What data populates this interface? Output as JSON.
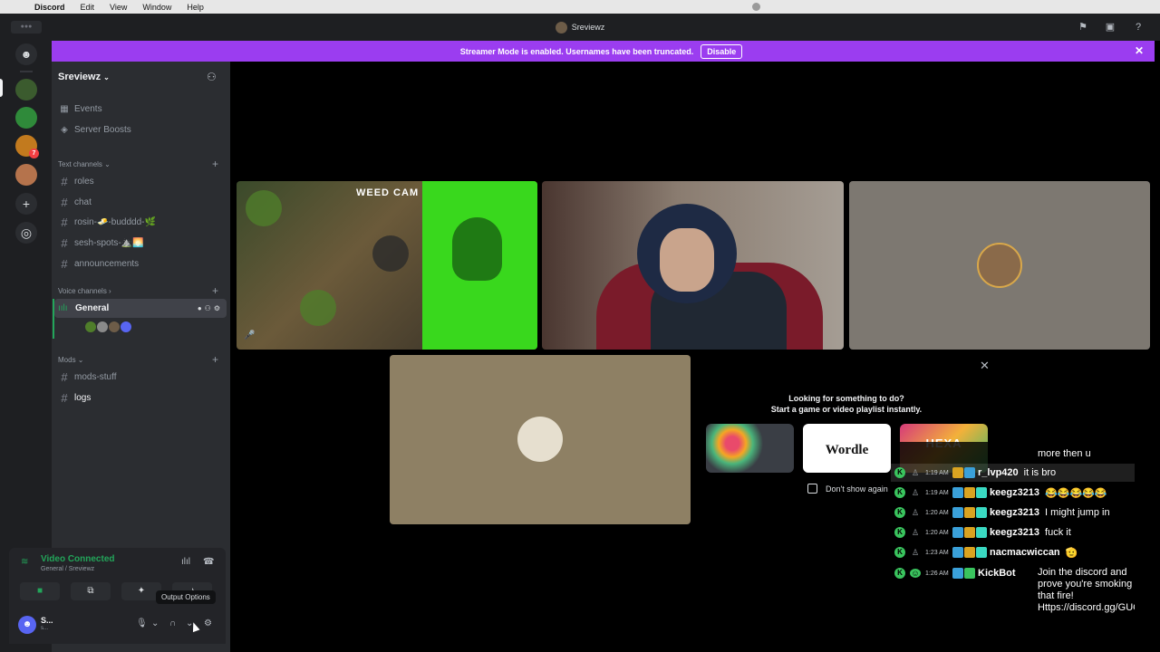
{
  "menubar": {
    "items": [
      "Discord",
      "Edit",
      "View",
      "Window",
      "Help"
    ]
  },
  "titlebar": {
    "title": "Sreviewz"
  },
  "banner": {
    "text": "Streamer Mode is enabled. Usernames have been truncated.",
    "button": "Disable"
  },
  "rail": {
    "badge": "7"
  },
  "sidebar": {
    "server_name": "Sreviewz",
    "top_items": [
      {
        "label": "Events",
        "icon": "calendar-icon"
      },
      {
        "label": "Server Boosts",
        "icon": "boost-icon"
      }
    ],
    "categories": {
      "text": "Text channels",
      "voice": "Voice channels",
      "mods": "Mods"
    },
    "text_channels": [
      "roles",
      "chat",
      "rosin-🧈-budddd-🌿",
      "sesh-spots-⛰️🌅",
      "announcements"
    ],
    "voice_channel": "General",
    "mods_channels": [
      "mods-stuff",
      "logs"
    ]
  },
  "voice_panel": {
    "status": "Video Connected",
    "sub": "General / Sreviewz"
  },
  "user": {
    "name": "S...",
    "sub": "s..."
  },
  "tooltip": "Output Options",
  "tiles": {
    "cam_label": "WEED CAM"
  },
  "activity": {
    "line1": "Looking for something to do?",
    "line2": "Start a game or video playlist instantly.",
    "cards": [
      "",
      "Wordle",
      "HEXA"
    ],
    "dont_show": "Don't show again"
  },
  "chat": {
    "top_text": "more then u",
    "messages": [
      {
        "time": "1:19 AM",
        "name": "r_lvp420",
        "text": "it is bro"
      },
      {
        "time": "1:19 AM",
        "name": "keegz3213",
        "text": "😂😂😂😂😂"
      },
      {
        "time": "1:20 AM",
        "name": "keegz3213",
        "text": "I might jump in"
      },
      {
        "time": "1:20 AM",
        "name": "keegz3213",
        "text": "fuck it"
      },
      {
        "time": "1:23 AM",
        "name": "nacmacwiccan",
        "text": "🫡"
      },
      {
        "time": "1:26 AM",
        "name": "KickBot",
        "text": ""
      }
    ],
    "kickbot_text": "Join the discord and prove you're smoking that fire! Https://discord.gg/GUGEWDhTxZ"
  },
  "colors": {
    "blurple": "#5865f2",
    "green": "#23a55a",
    "banner": "#9b3df0",
    "sidebar": "#2b2d31",
    "rail": "#1e1f22"
  }
}
